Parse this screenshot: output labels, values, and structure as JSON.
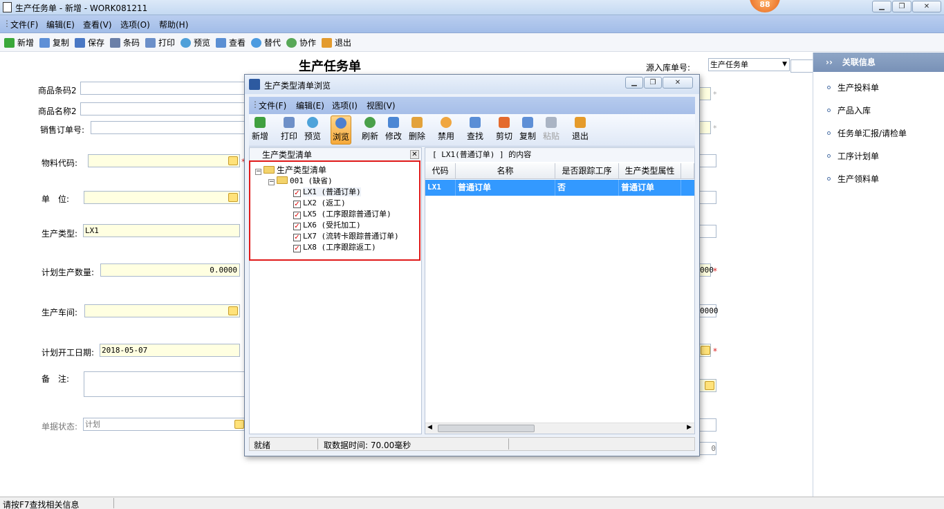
{
  "window": {
    "title": "生产任务单 - 新增 - WORK081211",
    "badge": "88"
  },
  "menu": [
    "文件(F)",
    "编辑(E)",
    "查看(V)",
    "选项(O)",
    "帮助(H)"
  ],
  "toolbar": [
    "新增",
    "复制",
    "保存",
    "条码",
    "打印",
    "预览",
    "查看",
    "替代",
    "协作",
    "退出"
  ],
  "form": {
    "title": "生产任务单",
    "source_label": "源入库单号:",
    "source_value": "生产任务单",
    "labels": {
      "barcode2": "商品条码2",
      "name2": "商品名称2",
      "sales_order": "销售订单号:",
      "material_code": "物料代码:",
      "unit": "单　位:",
      "prod_type": "生产类型:",
      "plan_qty": "计划生产数量:",
      "workshop": "生产车间:",
      "plan_start": "计划开工日期:",
      "remark": "备　注:",
      "doc_status": "单据状态:"
    },
    "values": {
      "prod_type": "LX1",
      "plan_qty": "0.0000",
      "plan_start": "2018-05-07",
      "doc_status": "计划",
      "right_qty": "000",
      "right_qty2": "0000",
      "right_zero": "0"
    }
  },
  "side": {
    "title": "关联信息",
    "items": [
      "生产投料单",
      "产品入库",
      "任务单汇报/请检单",
      "工序计划单",
      "生产领料单"
    ]
  },
  "status": {
    "hint": "请按F7查找相关信息"
  },
  "dialog": {
    "title": "生产类型清单浏览",
    "menu": [
      "文件(F)",
      "编辑(E)",
      "选项(I)",
      "视图(V)"
    ],
    "tools": [
      "新增",
      "打印",
      "预览",
      "浏览",
      "刷新",
      "修改",
      "删除",
      "禁用",
      "查找",
      "剪切",
      "复制",
      "粘贴",
      "退出"
    ],
    "tree_header": "生产类型清单",
    "tree": {
      "root": "生产类型清单",
      "group": "001 (缺省)",
      "items": [
        "LX1 (普通订单)",
        "LX2 (返工)",
        "LX5 (工序跟踪普通订单)",
        "LX6 (受托加工)",
        "LX7 (流转卡跟踪普通订单)",
        "LX8 (工序跟踪返工)"
      ]
    },
    "grid_caption": "[ LX1(普通订单) ] 的内容",
    "columns": [
      "代码",
      "名称",
      "是否跟踪工序",
      "生产类型属性"
    ],
    "row": [
      "LX1",
      "普通订单",
      "否",
      "普通订单"
    ],
    "status_ready": "就绪",
    "status_time": "取数据时间: 70.00毫秒"
  }
}
